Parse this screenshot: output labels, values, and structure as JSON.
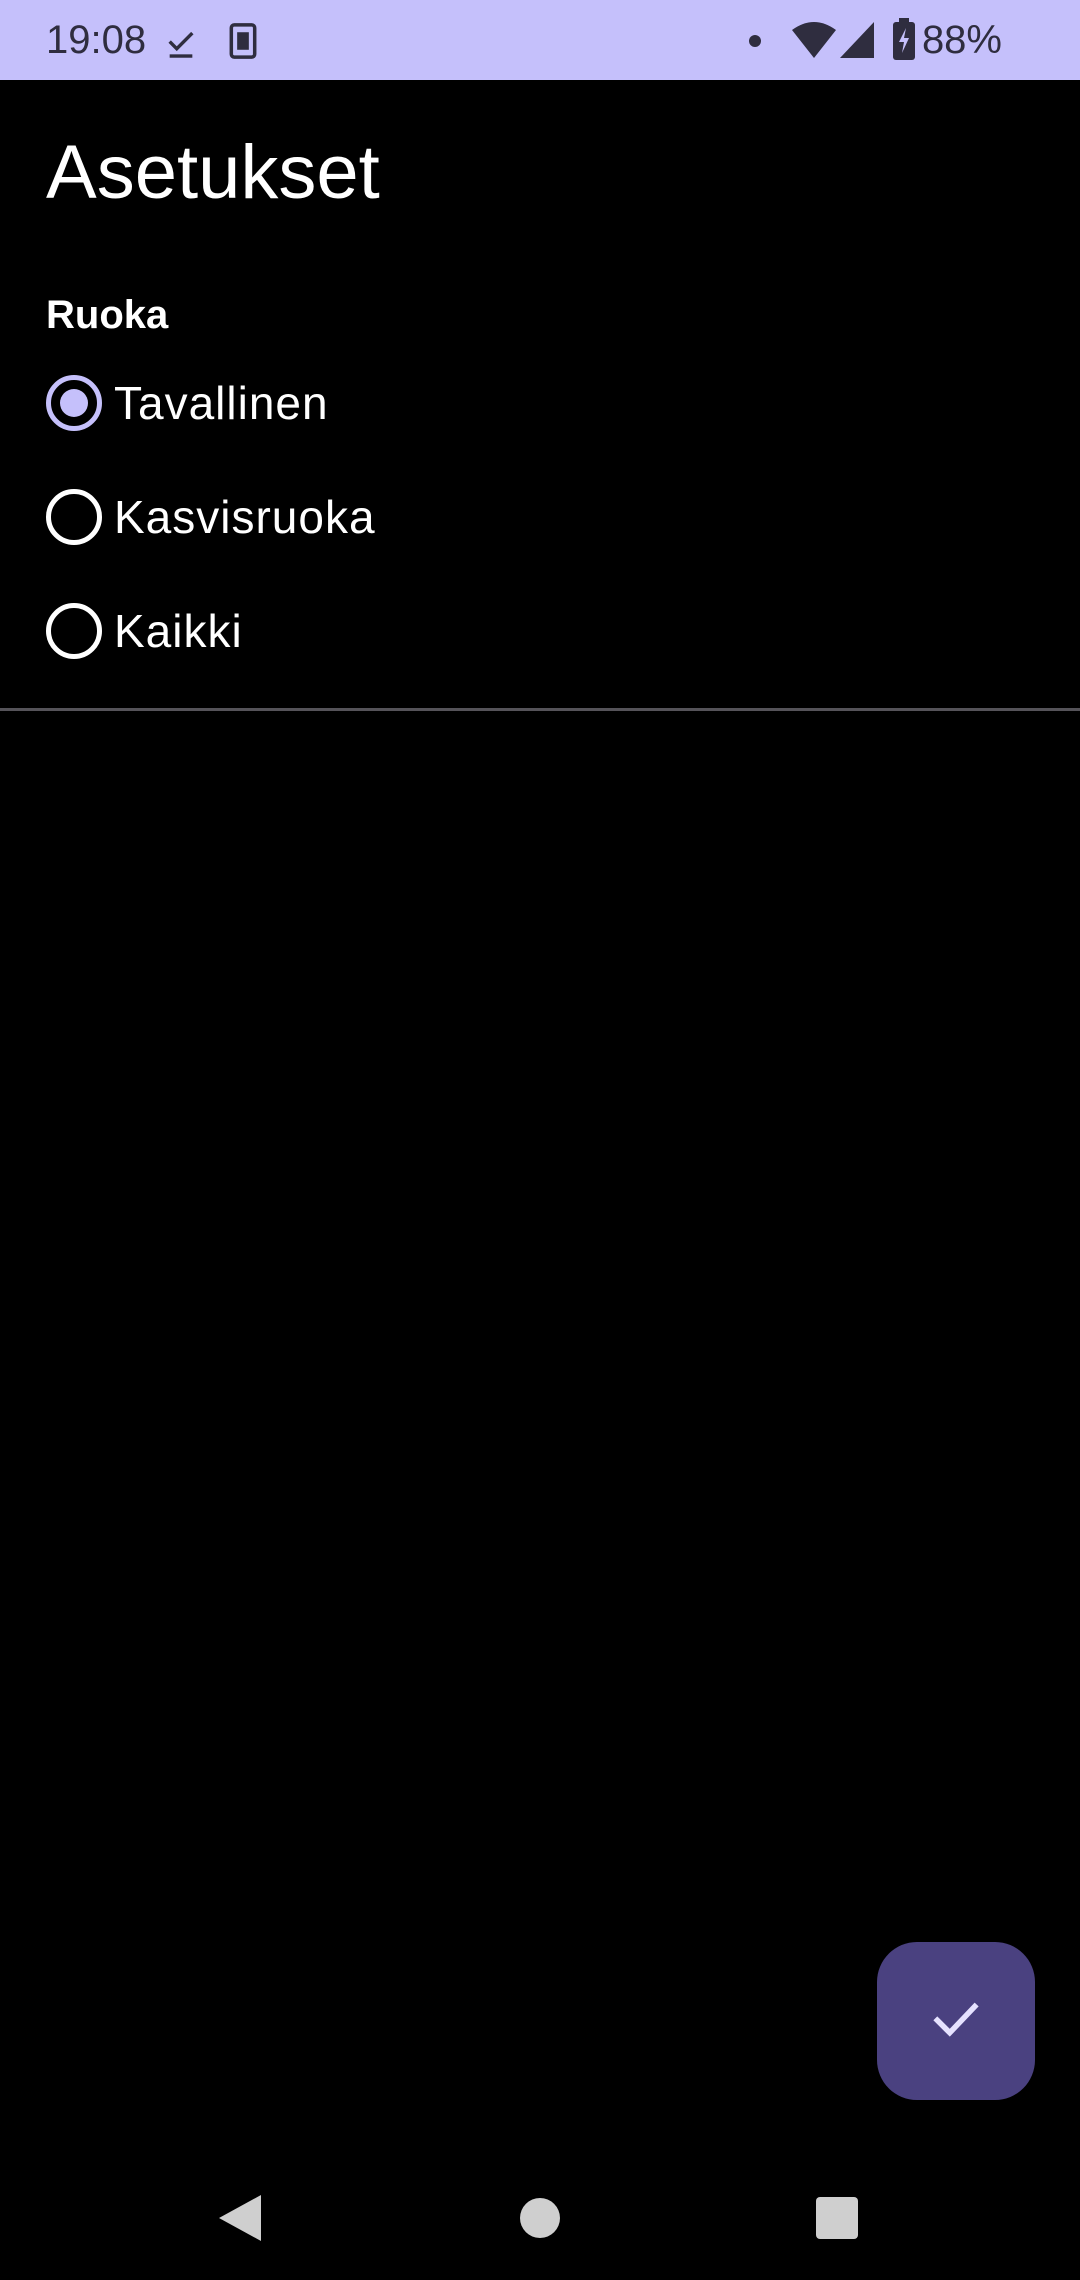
{
  "status_bar": {
    "time": "19:08",
    "battery_percent": "88%",
    "icons": [
      "download-done-icon",
      "sim-card-icon",
      "notification-dot-icon",
      "wifi-icon",
      "cellular-signal-icon",
      "battery-charging-icon"
    ],
    "background_color": "#c5c0fb"
  },
  "page": {
    "title": "Asetukset"
  },
  "food_section": {
    "title": "Ruoka",
    "options": [
      {
        "label": "Tavallinen",
        "selected": true
      },
      {
        "label": "Kasvisruoka",
        "selected": false
      },
      {
        "label": "Kaikki",
        "selected": false
      }
    ]
  },
  "fab": {
    "icon": "check-icon",
    "color": "#4a4180"
  },
  "nav_bar": {
    "buttons": [
      "back-icon",
      "home-icon",
      "recents-icon"
    ]
  },
  "colors": {
    "background": "#000000",
    "accent": "#c5c0fb",
    "text": "#ffffff"
  }
}
